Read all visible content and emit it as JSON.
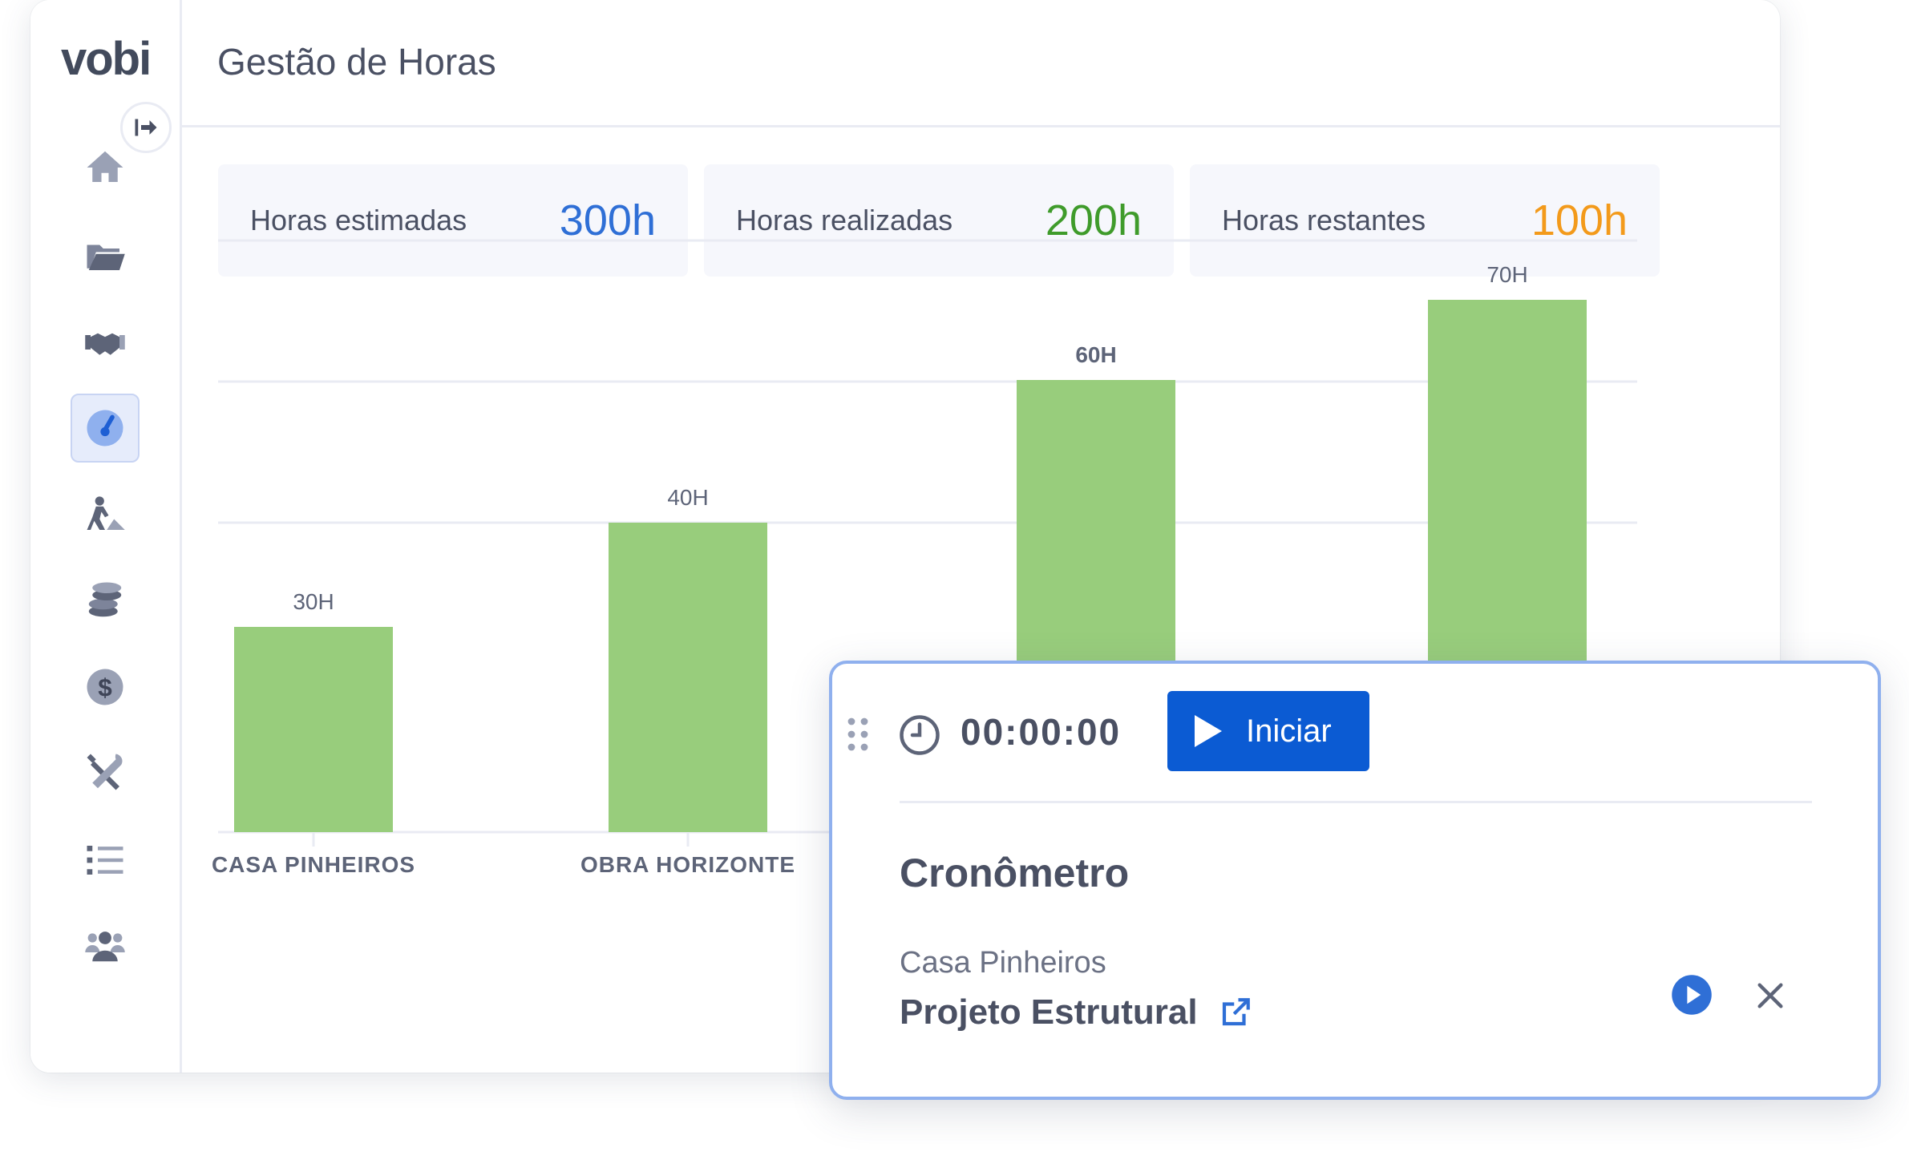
{
  "app": {
    "logo": "vobi",
    "page_title": "Gestão de Horas"
  },
  "sidebar": {
    "items": [
      {
        "icon": "home-icon"
      },
      {
        "icon": "folder-icon"
      },
      {
        "icon": "handshake-icon"
      },
      {
        "icon": "speedometer-icon",
        "active": true
      },
      {
        "icon": "worker-icon"
      },
      {
        "icon": "coins-icon"
      },
      {
        "icon": "dollar-icon"
      },
      {
        "icon": "tools-icon"
      },
      {
        "icon": "list-icon"
      },
      {
        "icon": "users-icon"
      }
    ]
  },
  "stats": [
    {
      "label": "Horas estimadas",
      "value": "300h",
      "color": "#2f6fd6"
    },
    {
      "label": "Horas realizadas",
      "value": "200h",
      "color": "#3f9b2b"
    },
    {
      "label": "Horas restantes",
      "value": "100h",
      "color": "#f39a1b"
    }
  ],
  "chart_data": {
    "type": "bar",
    "categories": [
      "CASA PINHEIROS",
      "OBRA HORIZONTE",
      "",
      ""
    ],
    "values": [
      30,
      40,
      60,
      70
    ],
    "data_labels": [
      "30H",
      "40H",
      "60H",
      "70H"
    ],
    "ylim": [
      0,
      80
    ],
    "grid": true,
    "bar_color": "#98cd7c"
  },
  "timer": {
    "time": "00:00:00",
    "start_label": "Iniciar",
    "title": "Cronômetro",
    "project": "Casa Pinheiros",
    "task": "Projeto Estrutural"
  }
}
